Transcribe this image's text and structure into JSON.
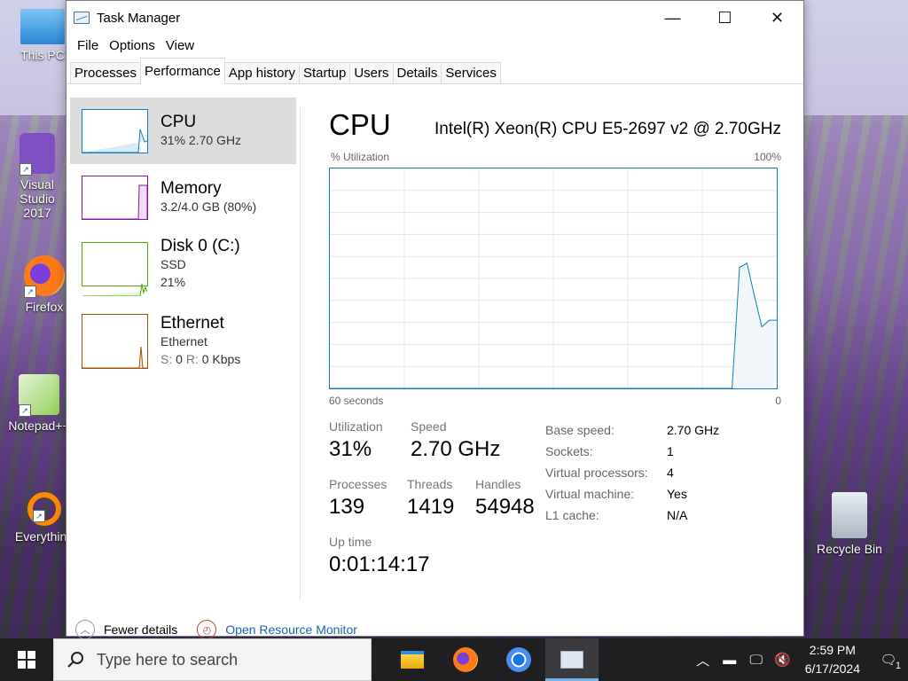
{
  "desktop": {
    "icons": [
      {
        "label": "This PC"
      },
      {
        "label": "Visual Studio 2017"
      },
      {
        "label": "Firefox"
      },
      {
        "label": "Notepad++"
      },
      {
        "label": "Everything"
      },
      {
        "label": "Recycle Bin"
      }
    ]
  },
  "window": {
    "title": "Task Manager",
    "controls": {
      "minimize": "—",
      "maximize": "☐",
      "close": "✕"
    }
  },
  "menu": {
    "file": "File",
    "options": "Options",
    "view": "View"
  },
  "tabs": [
    {
      "label": "Processes"
    },
    {
      "label": "Performance"
    },
    {
      "label": "App history"
    },
    {
      "label": "Startup"
    },
    {
      "label": "Users"
    },
    {
      "label": "Details"
    },
    {
      "label": "Services"
    }
  ],
  "active_tab": "Performance",
  "resources": [
    {
      "name": "CPU",
      "sub": "31%  2.70 GHz",
      "sub2": "",
      "color": "#117dbb"
    },
    {
      "name": "Memory",
      "sub": "3.2/4.0 GB (80%)",
      "sub2": "",
      "color": "#8b12ae"
    },
    {
      "name": "Disk 0 (C:)",
      "sub": "SSD",
      "sub2": "21%",
      "color": "#4da60c"
    },
    {
      "name": "Ethernet",
      "sub": "Ethernet",
      "sub2_label_s": "S:",
      "sub2_s": "0",
      "sub2_label_r": "R:",
      "sub2_r": "0 Kbps",
      "color": "#a74f01"
    }
  ],
  "cpu_panel": {
    "title": "CPU",
    "model": "Intel(R) Xeon(R) CPU E5-2697 v2 @ 2.70GHz",
    "utilization_axis": "% Utilization",
    "max_label": "100%",
    "time_label": "60 seconds",
    "min_label": "0",
    "utilization_label": "Utilization",
    "utilization": "31%",
    "speed_label": "Speed",
    "speed": "2.70 GHz",
    "processes_label": "Processes",
    "processes": "139",
    "threads_label": "Threads",
    "threads": "1419",
    "handles_label": "Handles",
    "handles": "54948",
    "uptime_label": "Up time",
    "uptime": "0:01:14:17",
    "specs": [
      {
        "k": "Base speed:",
        "v": "2.70 GHz"
      },
      {
        "k": "Sockets:",
        "v": "1"
      },
      {
        "k": "Virtual processors:",
        "v": "4"
      },
      {
        "k": "Virtual machine:",
        "v": "Yes"
      },
      {
        "k": "L1 cache:",
        "v": "N/A"
      }
    ],
    "history_percent": [
      0,
      0,
      0,
      0,
      0,
      0,
      0,
      0,
      0,
      0,
      0,
      0,
      0,
      0,
      0,
      0,
      0,
      0,
      0,
      0,
      0,
      0,
      0,
      0,
      0,
      0,
      0,
      0,
      0,
      0,
      0,
      0,
      0,
      0,
      0,
      0,
      0,
      0,
      0,
      0,
      0,
      0,
      0,
      0,
      0,
      0,
      0,
      0,
      0,
      0,
      0,
      0,
      0,
      0,
      0,
      55,
      57,
      42,
      28,
      31,
      31
    ]
  },
  "footer": {
    "fewer_details": "Fewer details",
    "resource_monitor": "Open Resource Monitor"
  },
  "taskbar": {
    "search_placeholder": "Type here to search",
    "time": "2:59 PM",
    "date": "6/17/2024",
    "notification_count": "1"
  }
}
